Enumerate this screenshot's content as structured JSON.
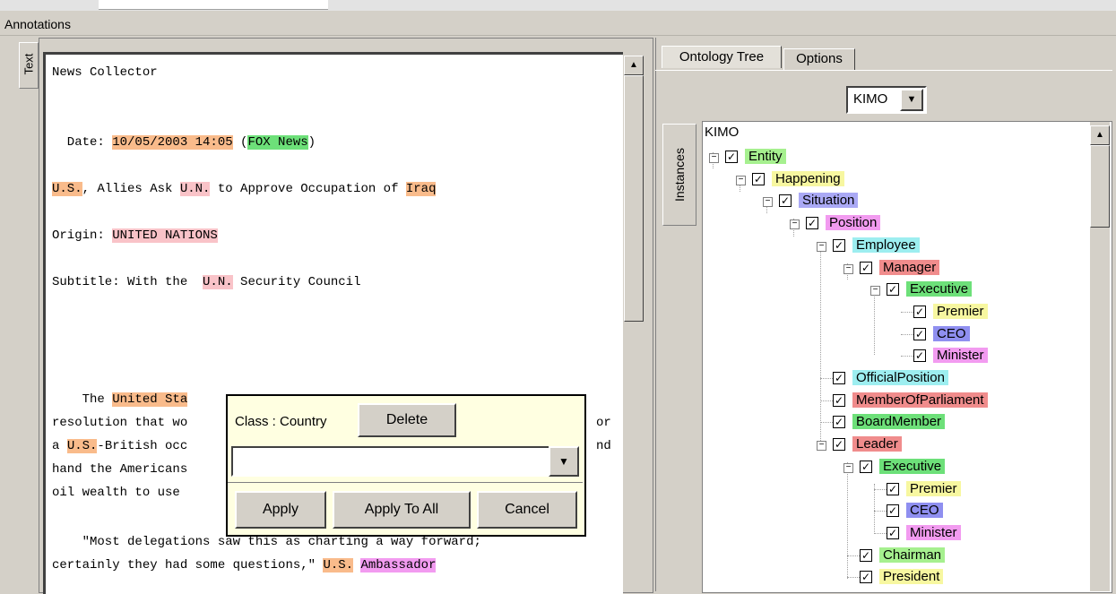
{
  "window": {
    "title": "Annotations"
  },
  "text_panel": {
    "side_tab": "Text",
    "lines": {
      "l1": "News Collector",
      "date_label": "  Date: ",
      "date_value": "10/05/2003 14:05",
      "date_paren_open": " (",
      "date_source": "FOX News",
      "date_paren_close": ")",
      "h_us": "U.S.",
      "h_mid1": ", Allies Ask ",
      "h_un": "U.N.",
      "h_mid2": " to Approve Occupation of ",
      "h_iraq": "Iraq",
      "origin_label": "Origin: ",
      "origin_value": "UNITED NATIONS",
      "sub_label": "Subtitle: With the  ",
      "sub_un": "U.N.",
      "sub_rest": " Security Council",
      "p1a": "    The ",
      "p1_us": "United Sta",
      "p2": "resolution that wo",
      "p2r": "or",
      "p3a": "a ",
      "p3_us": "U.S.",
      "p3b": "-British occ",
      "p3r": "nd",
      "p4": "hand the Americans",
      "p5": "oil wealth to use",
      "q1": "    \"Most delegations saw this as charting a way forward;",
      "q2a": "certainly they had some questions,\" ",
      "q2_us": "U.S.",
      "q2_sp": " ",
      "q2_amb": "Ambassador"
    }
  },
  "popup": {
    "class_label": "Class : Country",
    "delete_label": "Delete",
    "input_value": "",
    "apply_label": "Apply",
    "apply_all_label": "Apply To All",
    "cancel_label": "Cancel"
  },
  "right_panel": {
    "tabs": [
      "Ontology Tree",
      "Options"
    ],
    "ontology_select": "KIMO",
    "side_tab": "Instances",
    "tree_root": "KIMO",
    "tree": [
      {
        "label": "Entity",
        "color": "#a6f08f"
      },
      {
        "label": "Happening",
        "color": "#f7f7a0"
      },
      {
        "label": "Situation",
        "color": "#aaa9f5"
      },
      {
        "label": "Position",
        "color": "#f29bf0"
      },
      {
        "label": "Employee",
        "color": "#9deef0"
      },
      {
        "label": "Manager",
        "color": "#f08c8c"
      },
      {
        "label": "Executive",
        "color": "#6de079"
      },
      {
        "label": "Premier",
        "color": "#f7f7a0"
      },
      {
        "label": "CEO",
        "color": "#8f8ff0"
      },
      {
        "label": "Minister",
        "color": "#f29bf0"
      },
      {
        "label": "OfficialPosition",
        "color": "#9deef0"
      },
      {
        "label": "MemberOfParliament",
        "color": "#f08c8c"
      },
      {
        "label": "BoardMember",
        "color": "#6de079"
      },
      {
        "label": "Leader",
        "color": "#f08c8c"
      },
      {
        "label": "Executive",
        "color": "#6de079"
      },
      {
        "label": "Premier",
        "color": "#f7f7a0"
      },
      {
        "label": "CEO",
        "color": "#8f8ff0"
      },
      {
        "label": "Minister",
        "color": "#f29bf0"
      },
      {
        "label": "Chairman",
        "color": "#a6f08f"
      },
      {
        "label": "President",
        "color": "#f7f7a0"
      }
    ]
  }
}
